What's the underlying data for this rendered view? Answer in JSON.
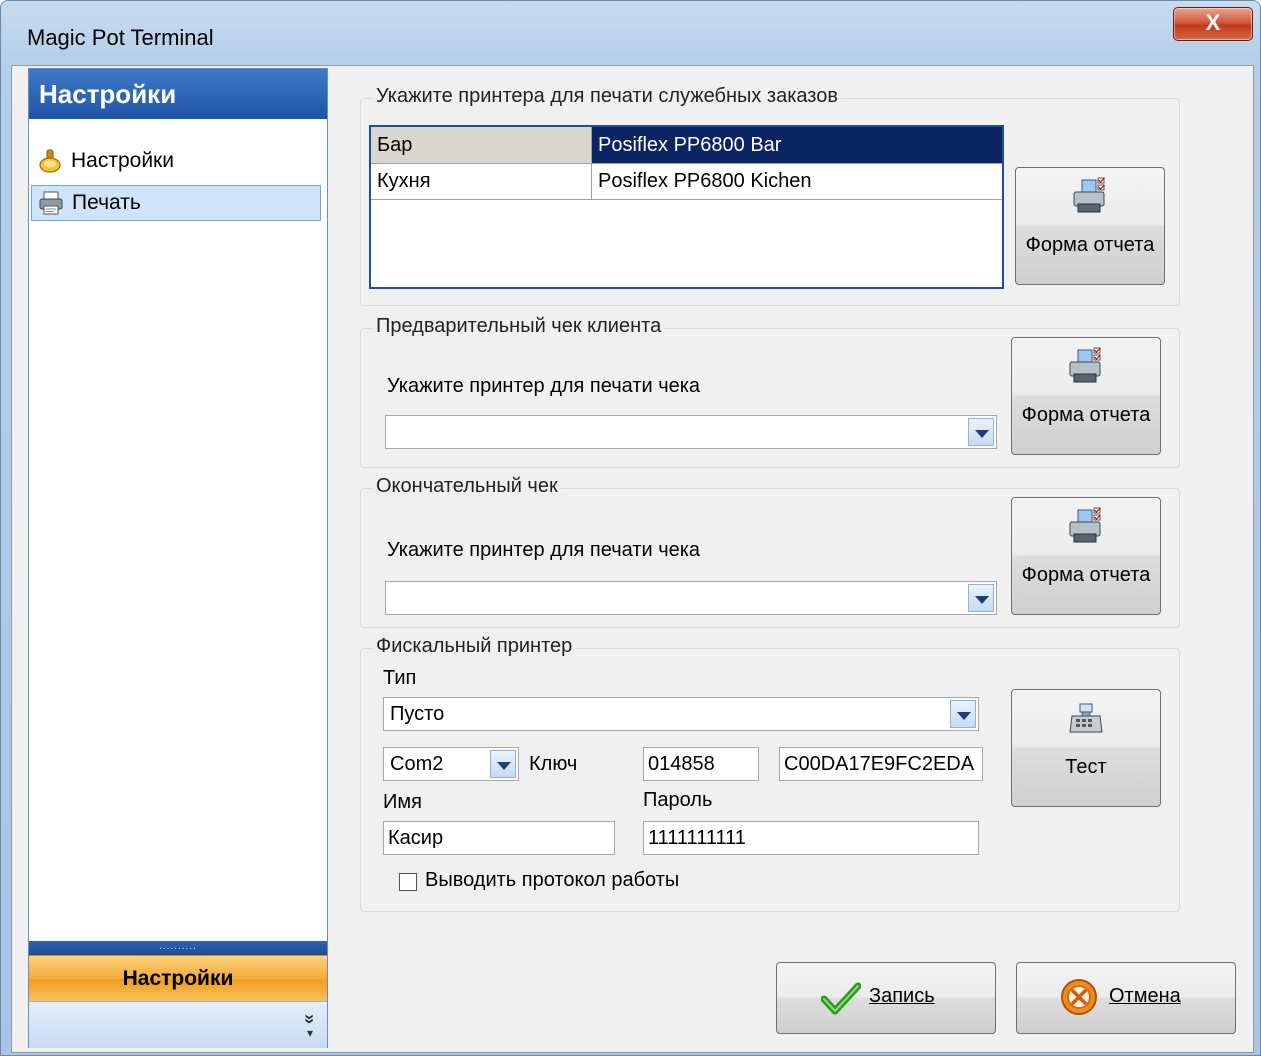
{
  "window": {
    "title": "Magic Pot Terminal",
    "close_label": "X"
  },
  "nav": {
    "header": "Настройки",
    "items": [
      {
        "label": "Настройки",
        "icon": "settings-gear-icon",
        "selected": false
      },
      {
        "label": "Печать",
        "icon": "printer-icon",
        "selected": true
      }
    ],
    "grip": "..........",
    "bottom_button": "Настройки",
    "chevron": "»"
  },
  "service_printers": {
    "title": "Укажите принтера для печати служебных заказов",
    "rows": [
      {
        "name": "Бар",
        "printer": "Posiflex PP6800 Bar",
        "selected": true
      },
      {
        "name": "Кухня",
        "printer": "Posiflex PP6800 Kichen",
        "selected": false
      }
    ],
    "report_button": "Форма отчета"
  },
  "precheck": {
    "title": "Предварительный чек клиента",
    "prompt": "Укажите принтер для печати чека",
    "selected": "",
    "report_button": "Форма отчета"
  },
  "finalcheck": {
    "title": "Окончательный чек",
    "prompt": "Укажите принтер для печати чека",
    "selected": "",
    "report_button": "Форма отчета"
  },
  "fiscal": {
    "title": "Фискальный принтер",
    "type_label": "Тип",
    "type_value": "Пусто",
    "port_value": "Com2",
    "key_label": "Ключ",
    "key_value1": "014858",
    "key_value2": "C00DA17E9FC2EDA",
    "name_label": "Имя",
    "name_value": "Касир",
    "password_label": "Пароль",
    "password_value": "1111111111",
    "log_checkbox_label": "Выводить протокол работы",
    "log_checked": false,
    "test_button": "Тест"
  },
  "footer": {
    "save_button": "Запись",
    "cancel_button": "Отмена"
  },
  "colors": {
    "nav_header": "#1f55a8",
    "selection": "#0b2464",
    "nav_bottom": "#f4a93a"
  }
}
